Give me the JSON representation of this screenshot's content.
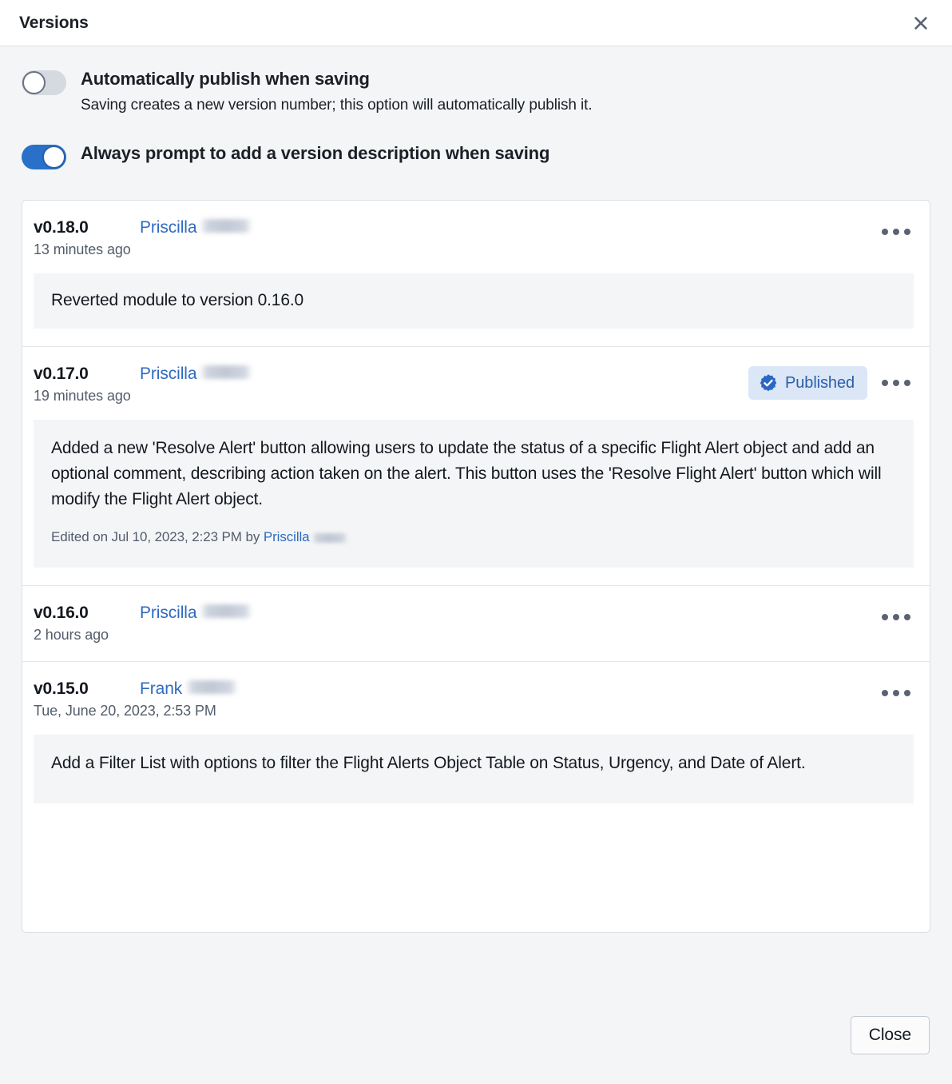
{
  "header": {
    "title": "Versions",
    "close_icon": "close-icon"
  },
  "settings": [
    {
      "label": "Automatically publish when saving",
      "description": "Saving creates a new version number; this option will automatically publish it.",
      "state": "off"
    },
    {
      "label": "Always prompt to add a version description when saving",
      "description": "",
      "state": "on"
    }
  ],
  "versions": [
    {
      "number": "v0.18.0",
      "author": "Priscilla",
      "time": "13 minutes ago",
      "badge": "",
      "description": "Reverted module to version 0.16.0",
      "edited": ""
    },
    {
      "number": "v0.17.0",
      "author": "Priscilla",
      "time": "19 minutes ago",
      "badge": "Published",
      "description": "Added a new 'Resolve Alert' button allowing users to update the status of a specific Flight Alert object and add an optional comment, describing action taken on the alert. This button uses the 'Resolve Flight Alert' button which will modify the Flight Alert object.",
      "edited_prefix": "Edited on Jul 10, 2023, 2:23 PM by ",
      "edited_author": "Priscilla"
    },
    {
      "number": "v0.16.0",
      "author": "Priscilla",
      "time": "2 hours ago",
      "badge": "",
      "description": "",
      "edited": ""
    },
    {
      "number": "v0.15.0",
      "author": "Frank",
      "time": "Tue, June 20, 2023, 2:53 PM",
      "badge": "",
      "description": "Add a Filter List with options to filter the Flight Alerts Object Table on Status, Urgency, and Date of Alert.",
      "edited": ""
    }
  ],
  "footer": {
    "close_label": "Close"
  },
  "colors": {
    "accent_blue": "#2970c9",
    "link_blue": "#2f6bbf",
    "badge_bg": "#dbe6f7",
    "badge_text": "#2b5fa8",
    "panel_bg": "#f4f5f7",
    "card_bg": "#ffffff",
    "border": "#dcdfe4",
    "muted_text": "#525c6b"
  }
}
